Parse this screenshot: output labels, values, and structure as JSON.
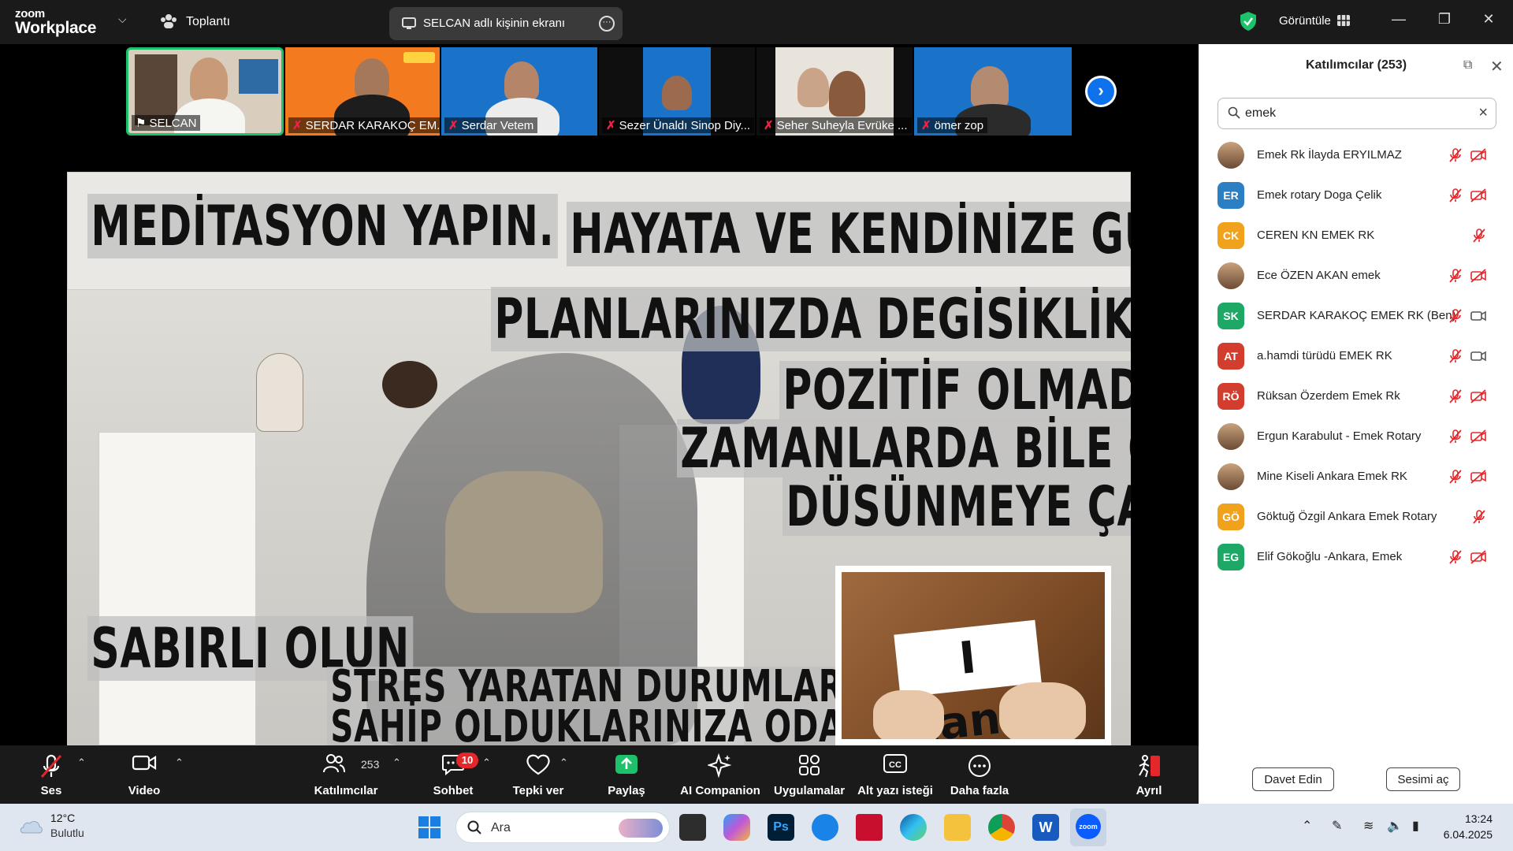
{
  "app": {
    "logo_line1": "zoom",
    "logo_line2": "Workplace",
    "meeting_label": "Toplantı",
    "share_label": "SELCAN adlı kişinin ekranı",
    "view_label": "Görüntüle",
    "accent": "#0e72ed",
    "secure_color": "#1ec16b"
  },
  "strip": {
    "thumbs": [
      {
        "name": "SELCAN",
        "muted": false,
        "bg": "#d9cdbd",
        "active": true
      },
      {
        "name": "SERDAR KARAKOÇ EM...",
        "muted": true,
        "bg": "#f47a1f"
      },
      {
        "name": "Serdar Vetem",
        "muted": true,
        "bg": "#1a73c8"
      },
      {
        "name": "Sezer Ünaldı Sinop Diy...",
        "muted": true,
        "bg": "#1a73c8"
      },
      {
        "name": "Seher Suheyla Evrüke ...",
        "muted": true,
        "bg": "#e8e4dc"
      },
      {
        "name": "ömer zop",
        "muted": true,
        "bg": "#1a73c8"
      }
    ]
  },
  "slide": {
    "lines": [
      "MEDİTASYON YAPIN.",
      "HAYATA VE KENDİNİZE GÜVENİN.",
      "PLANLARINIZDA DEGİSİKLİKLER YAPIN.",
      "POZİTİF OLMADIGINIZ",
      "ZAMANLARDA BİLE OLUMLU",
      "DÜSÜNMEYE ÇALISIN.",
      "SABIRLI OLUN",
      "STRES YARATAN DURUMLAR YERİNE,",
      "SAHİP OLDUKLARINIZA ODAKLANIN."
    ],
    "card_text": "I can't"
  },
  "panel": {
    "title": "Katılımcılar (253)",
    "search_value": "emek",
    "participants": [
      {
        "name": "Emek Rk İlayda ERYILMAZ",
        "initials": "",
        "color": "",
        "photo": true,
        "video": "off"
      },
      {
        "name": "Emek rotary Doga Çelik",
        "initials": "ER",
        "color": "#2d7fc4",
        "photo": false,
        "video": "off"
      },
      {
        "name": "CEREN KN EMEK RK",
        "initials": "CK",
        "color": "#f0a21c",
        "photo": false,
        "video": "none"
      },
      {
        "name": "Ece ÖZEN AKAN emek",
        "initials": "",
        "color": "",
        "photo": true,
        "video": "off"
      },
      {
        "name": "SERDAR KARAKOÇ EMEK RK (Ben)",
        "initials": "SK",
        "color": "#1ea865",
        "photo": false,
        "video": "on"
      },
      {
        "name": "a.hamdi türüdü EMEK RK",
        "initials": "AT",
        "color": "#d23d2e",
        "photo": false,
        "video": "on"
      },
      {
        "name": "Rüksan Özerdem Emek Rk",
        "initials": "RÖ",
        "color": "#d23d2e",
        "photo": false,
        "video": "off"
      },
      {
        "name": "Ergun Karabulut - Emek Rotary",
        "initials": "",
        "color": "",
        "photo": true,
        "video": "off"
      },
      {
        "name": "Mine Kiseli Ankara Emek RK",
        "initials": "",
        "color": "",
        "photo": true,
        "video": "off"
      },
      {
        "name": "Göktuğ Özgil Ankara Emek Rotary",
        "initials": "GÖ",
        "color": "#f0a21c",
        "photo": false,
        "video": "none"
      },
      {
        "name": "Elif Gökoğlu -Ankara, Emek",
        "initials": "EG",
        "color": "#1ea865",
        "photo": false,
        "video": "off"
      }
    ],
    "invite_label": "Davet Edin",
    "unmute_label": "Sesimi aç"
  },
  "toolbar": {
    "audio": "Ses",
    "video": "Video",
    "participants": "Katılımcılar",
    "participants_count": "253",
    "chat": "Sohbet",
    "chat_badge": "10",
    "react": "Tepki ver",
    "share": "Paylaş",
    "ai": "AI Companion",
    "apps": "Uygulamalar",
    "captions": "Alt yazı isteği",
    "more": "Daha fazla",
    "leave": "Ayrıl"
  },
  "taskbar": {
    "temp": "12°C",
    "condition": "Bulutlu",
    "search_placeholder": "Ara",
    "time": "13:24",
    "date": "6.04.2025"
  }
}
